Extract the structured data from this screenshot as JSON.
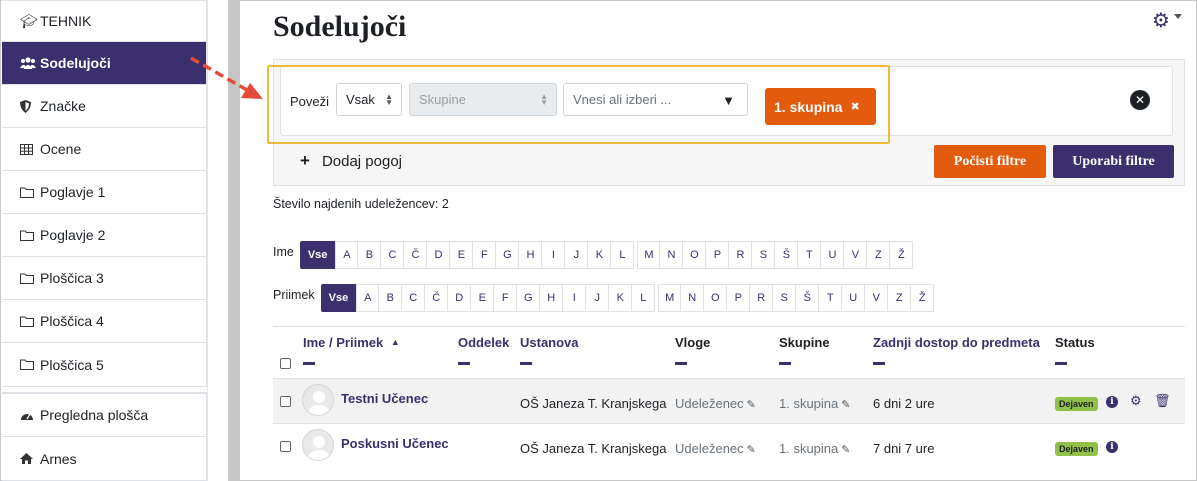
{
  "sidebar": {
    "items": [
      {
        "label": "TEHNIK",
        "icon": "graduation-cap-icon"
      },
      {
        "label": "Sodelujoči",
        "icon": "users-icon"
      },
      {
        "label": "Značke",
        "icon": "shield-icon"
      },
      {
        "label": "Ocene",
        "icon": "table-icon"
      },
      {
        "label": "Poglavje 1",
        "icon": "folder-icon"
      },
      {
        "label": "Poglavje 2",
        "icon": "folder-icon"
      },
      {
        "label": "Ploščica 3",
        "icon": "folder-icon"
      },
      {
        "label": "Ploščica 4",
        "icon": "folder-icon"
      },
      {
        "label": "Ploščica 5",
        "icon": "folder-icon"
      }
    ],
    "bottom_items": [
      {
        "label": "Pregledna plošča",
        "icon": "dashboard-icon"
      },
      {
        "label": "Arnes",
        "icon": "home-icon"
      }
    ]
  },
  "page": {
    "title": "Sodelujoči"
  },
  "filter": {
    "join_label": "Poveži",
    "join_value": "Vsak",
    "type_placeholder": "Skupine",
    "value_placeholder": "Vnesi ali izberi ...",
    "chip_label": "1. skupina",
    "add_condition": "Dodaj pogoj",
    "clear_button": "Počisti filtre",
    "apply_button": "Uporabi filtre"
  },
  "count_text": "Število najdenih udeležencev: 2",
  "initials": {
    "first_label": "Ime",
    "last_label": "Priimek",
    "all_label": "Vse",
    "letters": [
      "A",
      "B",
      "C",
      "Č",
      "D",
      "E",
      "F",
      "G",
      "H",
      "I",
      "J",
      "K",
      "L",
      "M",
      "N",
      "O",
      "P",
      "R",
      "S",
      "Š",
      "T",
      "U",
      "V",
      "Z",
      "Ž"
    ]
  },
  "table": {
    "headers": {
      "name": "Ime / Priimek",
      "dept": "Oddelek",
      "inst": "Ustanova",
      "roles": "Vloge",
      "groups": "Skupine",
      "last_access": "Zadnji dostop do predmeta",
      "status": "Status"
    },
    "rows": [
      {
        "name": "Testni Učenec",
        "inst": "OŠ Janeza T. Kranjskega",
        "role": "Udeleženec",
        "group": "1. skupina",
        "last_access": "6 dni 2 ure",
        "status": "Dejaven"
      },
      {
        "name": "Poskusni Učenec",
        "inst": "OŠ Janeza T. Kranjskega",
        "role": "Udeleženec",
        "group": "1. skupina",
        "last_access": "7 dni 7 ure",
        "status": "Dejaven"
      }
    ]
  },
  "colors": {
    "brand": "#3c2f6e",
    "accent": "#e35c0d",
    "highlight": "#f0b840",
    "active_badge": "#92c14a",
    "arrow": "#e84a3a"
  }
}
